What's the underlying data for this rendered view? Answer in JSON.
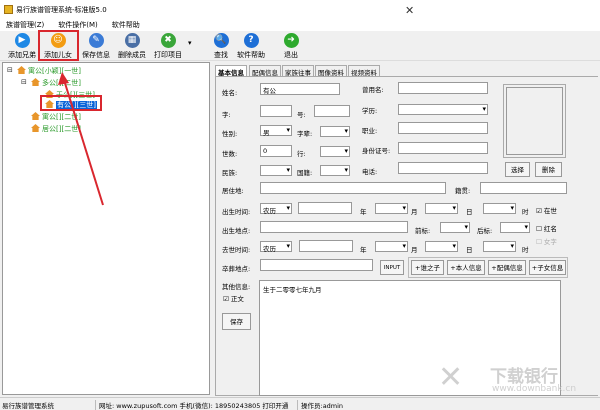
{
  "window": {
    "title": "易行族谱管理系统-标准版5.0",
    "close": "✕"
  },
  "menu": [
    "族谱管理(Z)",
    "软件操作(M)",
    "软件帮助"
  ],
  "toolbar": [
    {
      "label": "添加兄弟",
      "icon": "play-icon",
      "color": "#1e88e5",
      "glyph": "▶"
    },
    {
      "label": "添加儿女",
      "icon": "person-icon",
      "color": "#f39c12",
      "glyph": "☺"
    },
    {
      "label": "保存信息",
      "icon": "pencil-icon",
      "color": "#3b7bd6",
      "glyph": "✎"
    },
    {
      "label": "删除成员",
      "icon": "grid-icon",
      "color": "#4a6fa5",
      "glyph": "▦"
    },
    {
      "label": "打印项目",
      "icon": "tools-icon",
      "color": "#3aa63a",
      "glyph": "✖"
    },
    {
      "label": "查找",
      "icon": "search-icon",
      "color": "#1e6fd6",
      "glyph": "🔍"
    },
    {
      "label": "软件帮助",
      "icon": "help-icon",
      "color": "#1e6fd6",
      "glyph": "?"
    },
    {
      "label": "退出",
      "icon": "exit-icon",
      "color": "#2eaa2e",
      "glyph": "➜"
    }
  ],
  "tree": [
    "寓公[小颖][一世]",
    "多公[][二世]",
    "于公[][三世]",
    "有公[][三世]",
    "寓公[][二世]",
    "居公[][二世]"
  ],
  "tabs": [
    "基本信息",
    "配偶信息",
    "家族往事",
    "图像资料",
    "视频资料"
  ],
  "form": {
    "name_label": "姓名:",
    "name_value": "有公",
    "former_name_label": "曾用名:",
    "zi_label": "字:",
    "hao_label": "号:",
    "edu_label": "学历:",
    "gender_label": "性别:",
    "gender_value": "男",
    "generation_char_label": "字辈:",
    "job_label": "职业:",
    "gen_label": "世数:",
    "gen_value": "0",
    "rank_label": "行:",
    "id_label": "身份证号:",
    "ethnic_label": "民族:",
    "nationality_label": "国籍:",
    "phone_label": "电话:",
    "residence_label": "居住地:",
    "origin_label": "籍贯:",
    "birth_label": "出生时间:",
    "calendar": "农历",
    "year": "年",
    "month": "月",
    "day": "日",
    "hour": "时",
    "alive": "在世",
    "birthplace_label": "出生地点:",
    "prefix_label": "前标:",
    "suffix_label": "后标:",
    "red_name": "红名",
    "death_label": "去世时间:",
    "female": "女字",
    "burial_label": "卒葬地点:",
    "input_btn": "INPUT",
    "add_buttons": [
      "+谁之子",
      "+本人信息",
      "+配偶信息",
      "+子女信息"
    ],
    "other_label": "其他信息:",
    "body_text": "正文",
    "other_value": "生于二零零七年九月",
    "save": "保存",
    "photo_select": "选择",
    "photo_delete": "删除"
  },
  "status": {
    "app": "易行族谱管理系统",
    "contact": "网址: www.zupusoft.com 手机(微信): 18950243805 打印开通",
    "operator": "操作员:admin"
  },
  "watermark": {
    "brand": "下载银行",
    "url": "www.downbank.cn"
  },
  "annotation_color": "#d9272e"
}
